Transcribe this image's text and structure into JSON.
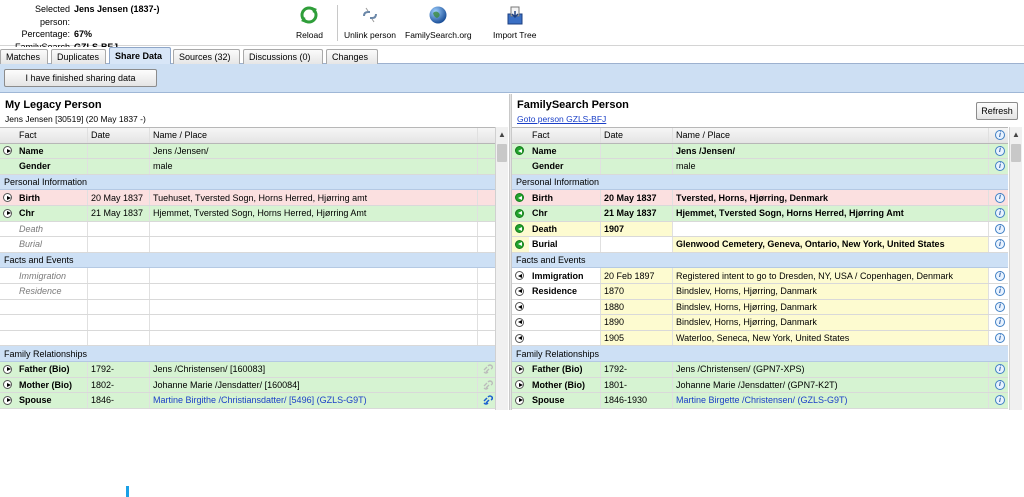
{
  "header": {
    "selected_label": "Selected person:",
    "selected_value": "Jens Jensen (1837-)",
    "percentage_label": "Percentage:",
    "percentage_value": "67%",
    "fsid_label": "FamilySearch ID:",
    "fsid_value": "GZLS-BFJ"
  },
  "toolbar": {
    "reload": "Reload",
    "unlink": "Unlink person",
    "familysearch": "FamilySearch.org",
    "import": "Import Tree"
  },
  "tabs": [
    "Matches",
    "Duplicates",
    "Share Data",
    "Sources (32)",
    "Discussions (0)",
    "Changes"
  ],
  "active_tab": "Share Data",
  "banner": {
    "finished_button": "I have finished sharing data"
  },
  "left": {
    "title": "My Legacy Person",
    "subtitle": "Jens Jensen [30519] (20 May 1837 -)",
    "columns": [
      "Fact",
      "Date",
      "Name / Place"
    ],
    "sections": {
      "personal": "Personal Information",
      "facts": "Facts and Events",
      "family": "Family Relationships"
    },
    "rows": {
      "name": {
        "fact": "Name",
        "date": "",
        "place": "Jens /Jensen/"
      },
      "gender": {
        "fact": "Gender",
        "date": "",
        "place": "male"
      },
      "birth": {
        "fact": "Birth",
        "date": "20 May 1837",
        "place": "Tuehuset, Tversted Sogn, Horns Herred, Hjørring amt"
      },
      "chr": {
        "fact": "Chr",
        "date": "21 May 1837",
        "place": "Hjemmet, Tversted Sogn, Horns Herred, Hjørring Amt"
      },
      "death": {
        "fact": "Death"
      },
      "burial": {
        "fact": "Burial"
      },
      "immigration": {
        "fact": "Immigration"
      },
      "residence": {
        "fact": "Residence"
      },
      "father": {
        "fact": "Father (Bio)",
        "date": "1792-",
        "place": "Jens /Christensen/ [160083]"
      },
      "mother": {
        "fact": "Mother (Bio)",
        "date": "1802-",
        "place": "Johanne Marie /Jensdatter/ [160084]"
      },
      "spouse": {
        "fact": "Spouse",
        "date": "1846-",
        "place": "Martine Birgithe /Christiansdatter/ [5496] (GZLS-G9T)"
      }
    }
  },
  "right": {
    "title": "FamilySearch Person",
    "goto": "Goto person GZLS-BFJ",
    "refresh": "Refresh",
    "columns": [
      "Fact",
      "Date",
      "Name / Place"
    ],
    "sections": {
      "personal": "Personal Information",
      "facts": "Facts and Events",
      "family": "Family Relationships"
    },
    "rows": {
      "name": {
        "fact": "Name",
        "date": "",
        "place": "Jens /Jensen/"
      },
      "gender": {
        "fact": "Gender",
        "date": "",
        "place": "male"
      },
      "birth": {
        "fact": "Birth",
        "date": "20 May 1837",
        "place": "Tversted, Horns, Hjørring, Denmark"
      },
      "chr": {
        "fact": "Chr",
        "date": "21 May 1837",
        "place": "Hjemmet, Tversted Sogn, Horns Herred, Hjørring Amt"
      },
      "death": {
        "fact": "Death",
        "date": "1907",
        "place": ""
      },
      "burial": {
        "fact": "Burial",
        "date": "",
        "place": "Glenwood Cemetery, Geneva, Ontario, New York, United States"
      },
      "immigration": {
        "fact": "Immigration",
        "date": "20 Feb 1897",
        "place": "Registered intent to go to Dresden, NY, USA / Copenhagen, Denmark"
      },
      "residence": {
        "fact": "Residence",
        "date": "1870",
        "place": "Bindslev, Horns, Hjørring, Danmark"
      },
      "res2": {
        "date": "1880",
        "place": "Bindslev, Horns, Hjørring, Danmark"
      },
      "res3": {
        "date": "1890",
        "place": "Bindslev, Horns, Hjørring, Danmark"
      },
      "res4": {
        "date": "1905",
        "place": "Waterloo, Seneca, New York, United States"
      },
      "father": {
        "fact": "Father (Bio)",
        "date": "1792-",
        "place": "Jens /Christensen/ (GPN7-XPS)"
      },
      "mother": {
        "fact": "Mother (Bio)",
        "date": "1801-",
        "place": "Johanne Marie /Jensdatter/ (GPN7-K2T)"
      },
      "spouse": {
        "fact": "Spouse",
        "date": "1846-1930",
        "place": "Martine Birgette /Christensen/ (GZLS-G9T)"
      }
    }
  },
  "colors": {
    "match": "#d6f3d2",
    "diff": "#fbe0e0",
    "new": "#fdfbd0",
    "section": "#cde0f5",
    "banner": "#cddff3"
  }
}
